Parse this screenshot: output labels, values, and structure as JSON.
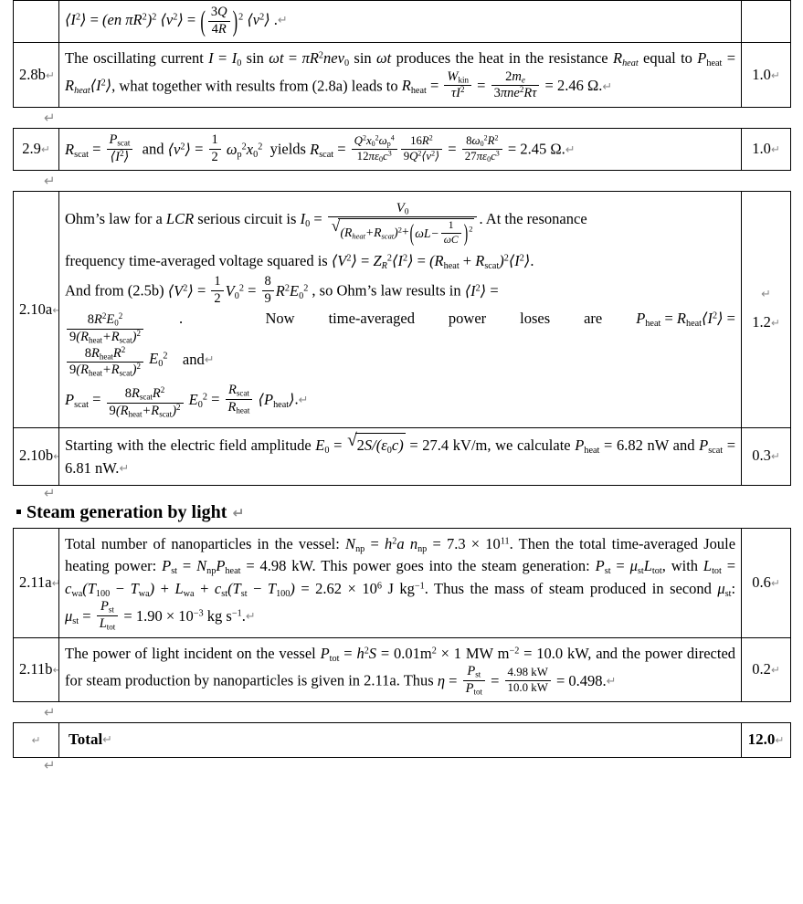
{
  "document": {
    "type": "physics-solution-grading-table",
    "heading": {
      "bullet": "square-bullet",
      "text": "Steam generation by light"
    },
    "return_mark": "↵"
  },
  "table_1": {
    "rows": [
      {
        "label": "",
        "score": "",
        "name": "current-mean-square-row",
        "body_plain": "⟨I²⟩ = (en πR²)² ⟨v²⟩ = (3Q/4R)² ⟨v²⟩ ."
      },
      {
        "label": "2.8b",
        "score": "1.0",
        "name": "row-2-8b",
        "body_plain": "The oscillating current I = I₀ sin ωt = πR²nev₀ sin ωt produces the heat in the resistance R_heat equal to P_heat = R_heat⟨I²⟩, what together with results from (2.8a) leads to R_heat = W_kin/(τI²) = 2m_e/(3πne²Rτ) = 2.46 Ω."
      }
    ]
  },
  "table_2": {
    "rows": [
      {
        "label": "2.9",
        "score": "1.0",
        "name": "row-2-9",
        "body_plain": "R_scat = P_scat/⟨I²⟩ and ⟨v²⟩ = ½ ωₚ²x₀² yields R_scat = Q²x₀²ωₚ⁴/(12πε₀c³) · 16R²/(9Q²⟨v²⟩) = 8ω₀²R²/(27πε₀c³) = 2.45 Ω."
      }
    ]
  },
  "table_3": {
    "rows": [
      {
        "label": "2.10a",
        "score": "1.2",
        "name": "row-2-10a",
        "body_plain": "Ohm’s law for a LCR serious circuit is I₀ = V₀/√((R_heat+R_scat)²+(ωL−1/ωC)²). At the resonance frequency time-averaged voltage squared is ⟨V²⟩ = Z_R²⟨I²⟩ = (R_heat + R_scat)²⟨I²⟩. And from (2.5b) ⟨V²⟩ = ½V₀² = (8/9)R²E₀² , so Ohm’s law results in ⟨I²⟩ = 8R²E₀²/(9(R_heat+R_scat)²) . Now time-averaged power loses are P_heat = R_heat⟨I²⟩ = 8R_heatR²/(9(R_heat+R_scat)²) E₀² and P_scat = 8R_scatR²/(9(R_heat+R_scat)²) E₀² = (R_scat/R_heat)⟨P_heat⟩."
      },
      {
        "label": "2.10b",
        "score": "0.3",
        "name": "row-2-10b",
        "body_plain": "Starting with the electric field amplitude E₀ = √(2S/(ε₀c)) = 27.4 kV/m, we calculate P_heat = 6.82 nW and P_scat = 6.81 nW."
      }
    ]
  },
  "table_4": {
    "rows": [
      {
        "label": "2.11a",
        "score": "0.6",
        "name": "row-2-11a",
        "body_plain": "Total number of nanoparticles in the vessel: N_np = h²a n_np = 7.3 × 10¹¹. Then the total time-averaged Joule heating power: P_st = N_npP_heat = 4.98 kW. This power goes into the steam generation: P_st = μ_stL_tot, with L_tot = c_wa(T₁₀₀ − T_wa) + L_wa + c_st(T_st − T₁₀₀) = 2.62 × 10⁶ J kg⁻¹. Thus the mass of steam produced in second μ_st: μ_st = P_st/L_tot = 1.90 × 10⁻³ kg s⁻¹."
      },
      {
        "label": "2.11b",
        "score": "0.2",
        "name": "row-2-11b",
        "body_plain": "The power of light incident on the vessel P_tot = h²S = 0.01m² × 1 MW m⁻² = 10.0 kW, and the power directed for steam production by nanoparticles is given in 2.11a. Thus η = P_st/P_tot = 4.98 kW/10.0 kW = 0.498."
      }
    ]
  },
  "table_total": {
    "label": "",
    "text": "Total",
    "score": "12.0",
    "name": "row-total"
  },
  "values": {
    "R_heat": "2.46 Ω",
    "R_scat": "2.45 Ω",
    "E_0": "27.4 kV/m",
    "P_heat": "6.82 nW",
    "P_scat": "6.81 nW",
    "N_np": "7.3 × 10¹¹",
    "P_st": "4.98 kW",
    "L_tot": "2.62 × 10⁶ J kg⁻¹",
    "mu_st": "1.90 × 10⁻³ kg s⁻¹",
    "P_tot": "10.0 kW",
    "eta": "0.498",
    "scores": [
      "1.0",
      "1.0",
      "1.2",
      "0.3",
      "0.6",
      "0.2"
    ],
    "total_score": "12.0"
  },
  "labels": {
    "r_2_8b": "2.8b",
    "r_2_9": "2.9",
    "r_2_10a": "2.10a",
    "r_2_10b": "2.10b",
    "r_2_11a": "2.11a",
    "r_2_11b": "2.11b"
  },
  "colors": {
    "text": "#000000",
    "return_mark": "#8c8c8c",
    "border": "#000000",
    "background": "#ffffff"
  }
}
